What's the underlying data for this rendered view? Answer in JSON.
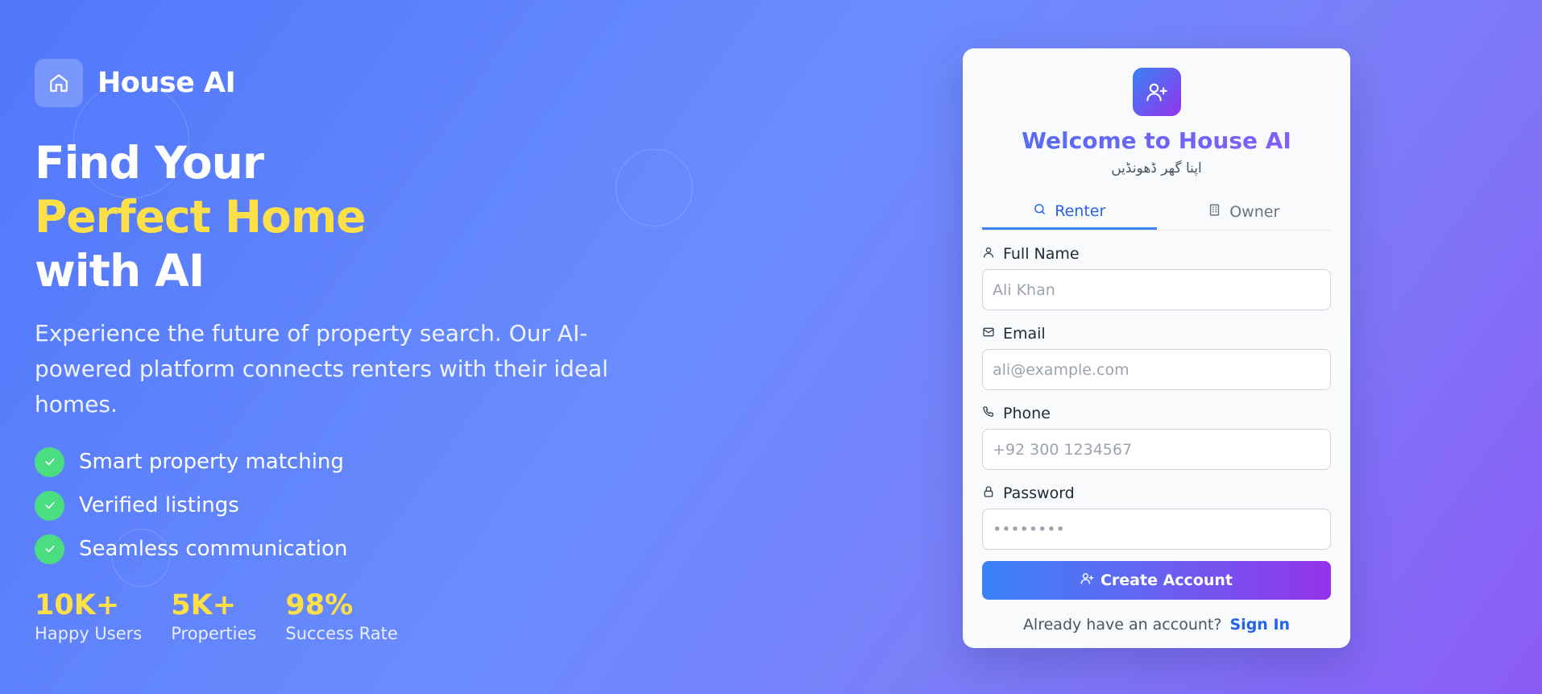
{
  "brand": {
    "name": "House AI",
    "icon": "home-icon"
  },
  "hero": {
    "line1": "Find Your",
    "line2": "Perfect Home",
    "line3": "with AI"
  },
  "description": "Experience the future of property search. Our AI-powered platform connects renters with their ideal homes.",
  "features": [
    {
      "label": "Smart property matching"
    },
    {
      "label": "Verified listings"
    },
    {
      "label": "Seamless communication"
    }
  ],
  "stats": [
    {
      "value": "10K+",
      "label": "Happy Users"
    },
    {
      "value": "5K+",
      "label": "Properties"
    },
    {
      "value": "98%",
      "label": "Success Rate"
    }
  ],
  "card": {
    "title": "Welcome to House AI",
    "subtitle": "اپنا گھر ڈھونڈیں",
    "tabs": [
      {
        "label": "Renter",
        "icon": "search-icon",
        "active": true
      },
      {
        "label": "Owner",
        "icon": "building-icon",
        "active": false
      }
    ],
    "fields": {
      "name": {
        "label": "Full Name",
        "placeholder": "Ali Khan",
        "icon": "user-icon"
      },
      "email": {
        "label": "Email",
        "placeholder": "ali@example.com",
        "icon": "mail-icon"
      },
      "phone": {
        "label": "Phone",
        "placeholder": "+92 300 1234567",
        "icon": "phone-icon"
      },
      "password": {
        "label": "Password",
        "placeholder": "••••••••",
        "icon": "lock-icon"
      }
    },
    "submit_label": "Create Account",
    "signin_prompt": "Already have an account?",
    "signin_link": "Sign In"
  },
  "colors": {
    "accent_yellow": "#fde047",
    "check_green": "#4ade80",
    "link_blue": "#2563eb",
    "gradient_start": "#3b82f6",
    "gradient_end": "#9333ea"
  }
}
